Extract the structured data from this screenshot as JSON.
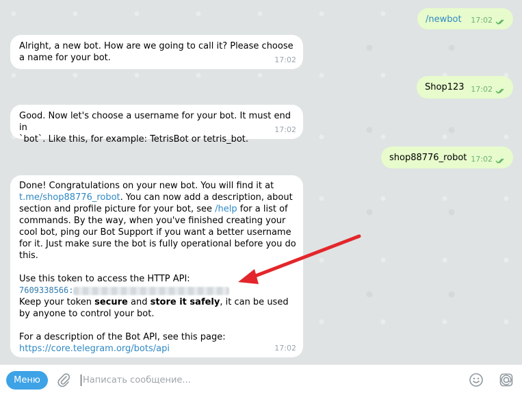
{
  "messages": {
    "m1": {
      "text": "/newbot",
      "time": "17:02"
    },
    "m2": {
      "text": "Alright, a new bot. How are we going to call it? Please choose a name for your bot.",
      "time": "17:02"
    },
    "m3": {
      "text": "Shop123",
      "time": "17:02"
    },
    "m4": {
      "line1": "Good. Now let's choose a username for your bot. It must end in",
      "line2": "`bot`. Like this, for example: TetrisBot or tetris_bot.",
      "time": "17:02"
    },
    "m5": {
      "text": "shop88776_robot",
      "time": "17:02"
    },
    "m6": {
      "intro": "Done! Congratulations on your new bot. You will find it at",
      "bot_link": "t.me/shop88776_robot",
      "after_link": ". You can now add a description, about section and profile picture for your bot, see",
      "help_link": "/help",
      "after_help": "for a list of commands. By the way, when you've finished creating your cool bot, ping our Bot Support if you want a better username for it. Just make sure the bot is fully operational before you do this.",
      "token_intro": "Use this token to access the HTTP API:",
      "token_prefix": "7609338566:",
      "keep_1": "Keep your token ",
      "secure": "secure",
      "and": " and ",
      "store": "store it safely",
      "keep_2": ", it can be used by anyone to control your bot.",
      "api_intro": "For a description of the Bot API, see this page:",
      "api_link": "https://core.telegram.org/bots/api",
      "time": "17:02"
    }
  },
  "composer": {
    "menu_label": "Меню",
    "placeholder": "Написать сообщение..."
  },
  "colors": {
    "incoming": "#ffffff",
    "outgoing": "#e7fbcc",
    "link": "#2f88c4",
    "menu_button": "#3ea2e6",
    "arrow": "#e3262b"
  },
  "icons": {
    "read_receipt": "double-check-icon",
    "attach": "paperclip-icon",
    "emoji": "smile-icon",
    "bot_commands": "commands-icon"
  }
}
